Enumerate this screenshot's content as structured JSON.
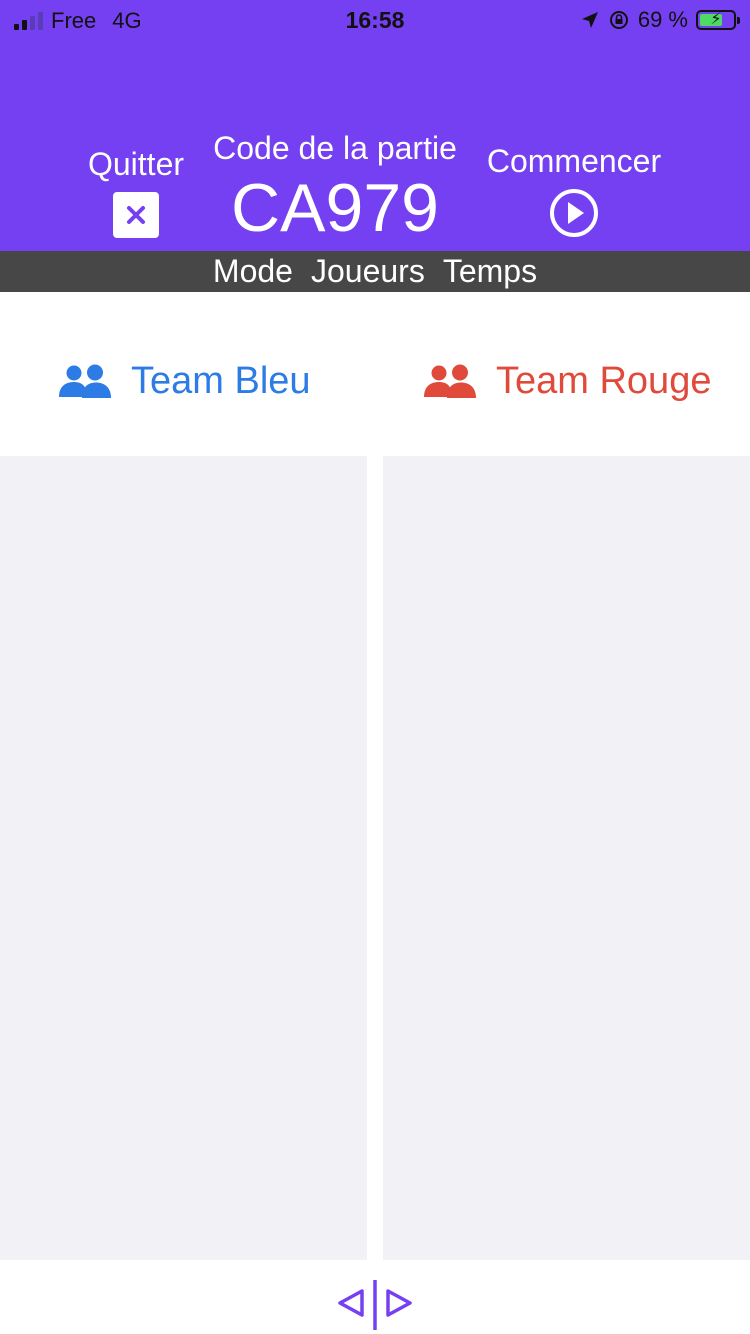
{
  "status_bar": {
    "carrier": "Free",
    "network": "4G",
    "time": "16:58",
    "battery_percent": "69 %",
    "battery_level": 0.69,
    "icons": [
      "signal-icon",
      "location-arrow-icon",
      "orientation-lock-icon",
      "battery-icon"
    ]
  },
  "header": {
    "quit_label": "Quitter",
    "code_label": "Code de la partie",
    "code_value": "CA979",
    "start_label": "Commencer",
    "icons": [
      "close-icon",
      "play-circle-icon"
    ]
  },
  "tabs": [
    {
      "label": "Mode"
    },
    {
      "label": "Joueurs"
    },
    {
      "label": "Temps"
    }
  ],
  "teams": [
    {
      "name": "Team Bleu",
      "color": "#2d7be5",
      "icon": "users-icon"
    },
    {
      "name": "Team Rouge",
      "color": "#e04a3b",
      "icon": "users-icon"
    }
  ],
  "colors": {
    "header_bg": "#7540f1",
    "tabs_bg": "#474747",
    "panel_bg": "#f1f1f6",
    "accent": "#7540f1"
  },
  "bottom_nav": {
    "icons": [
      "arrow-left-icon",
      "arrow-right-icon"
    ]
  }
}
